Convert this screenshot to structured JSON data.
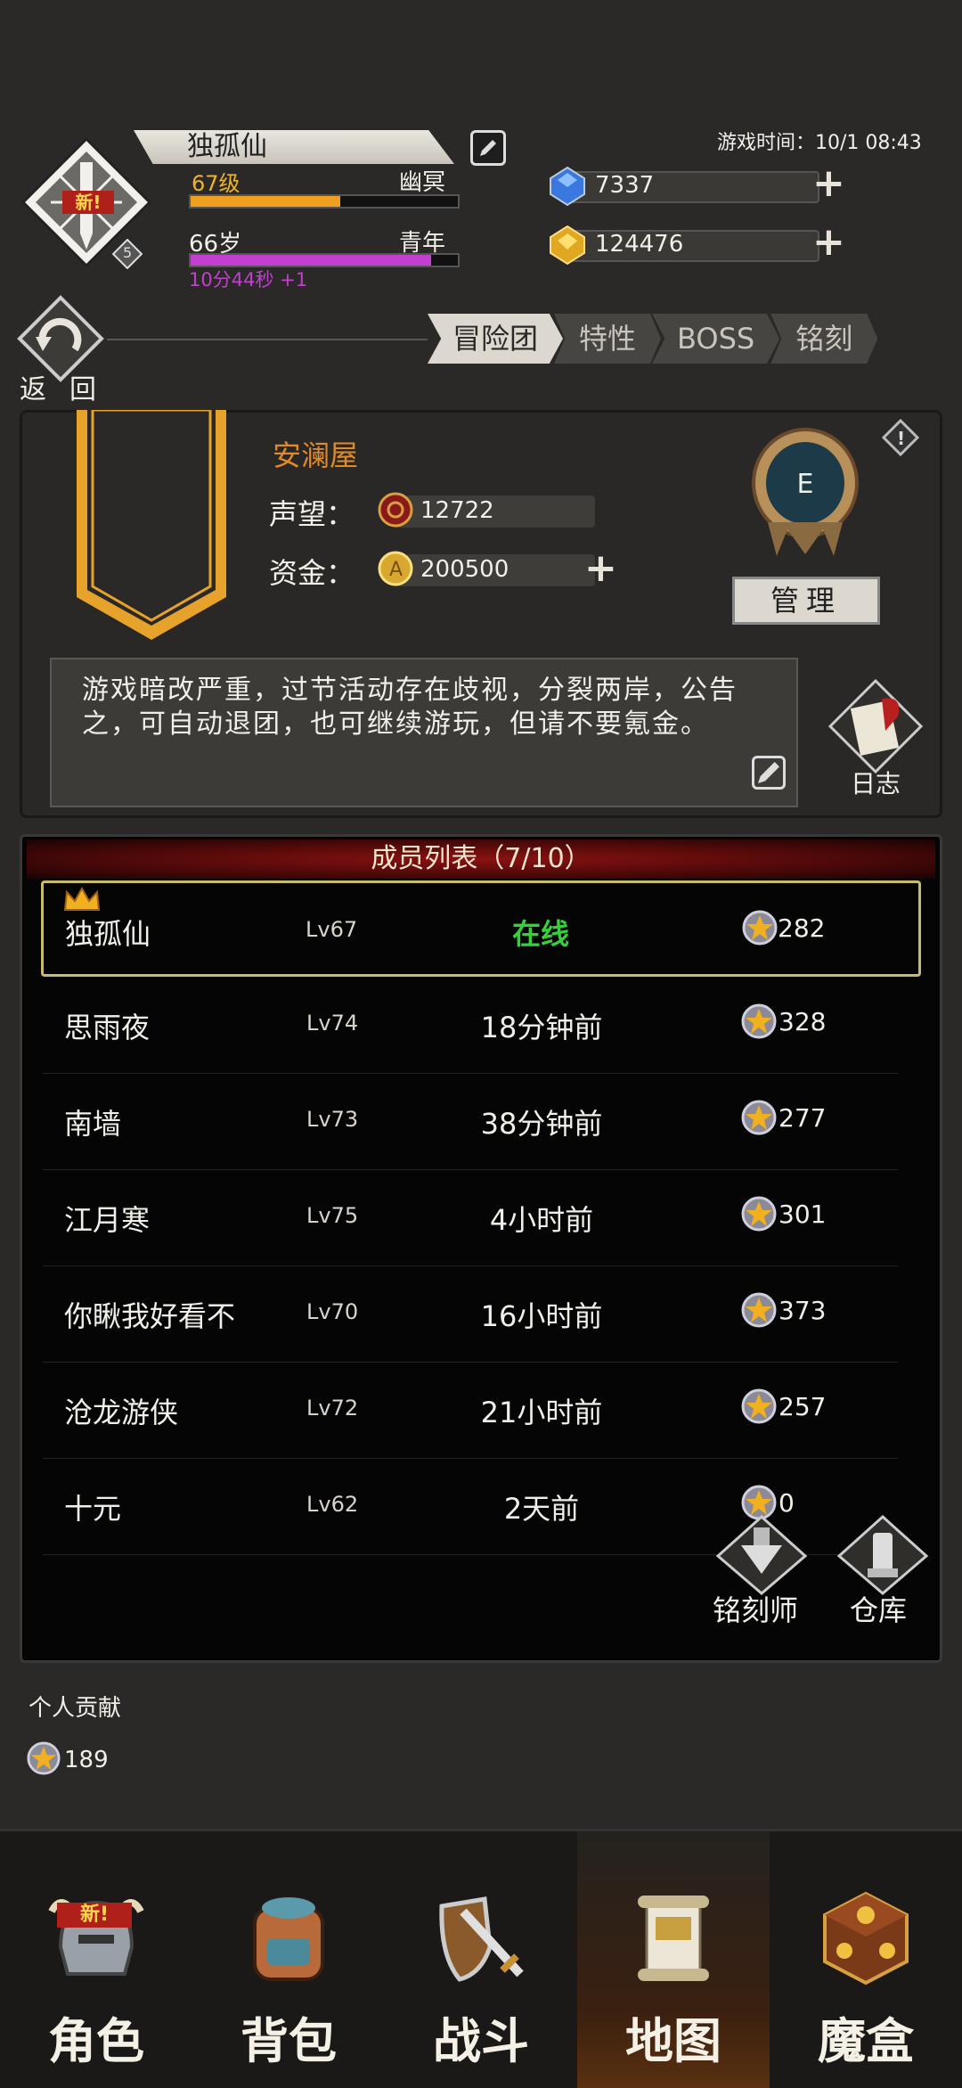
{
  "header": {
    "name": "独孤仙",
    "badge_new": "新!",
    "badge_level": "5",
    "level": "67级",
    "realm": "幽冥",
    "age": "66岁",
    "stage": "青年",
    "timer": "10分44秒 +1",
    "game_time": "游戏时间：10/1 08:43",
    "exp_progress": 0.56,
    "age_progress": 0.9
  },
  "currency": {
    "gems": "7337",
    "gold": "124476"
  },
  "back_label": "返回",
  "tabs": [
    {
      "label": "冒险团",
      "active": true
    },
    {
      "label": "特性",
      "active": false
    },
    {
      "label": "BOSS",
      "active": false
    },
    {
      "label": "铭刻",
      "active": false
    }
  ],
  "guild": {
    "name": "安澜屋",
    "reputation_label": "声望：",
    "reputation": "12722",
    "funds_label": "资金：",
    "funds": "200500",
    "rank": "E",
    "manage_label": "管理",
    "notice": "游戏暗改严重，过节活动存在歧视，分裂两岸，公告之，可自动退团，也可继续游玩，但请不要氪金。",
    "log_label": "日志"
  },
  "members": {
    "title": "成员列表（7/10）",
    "rows": [
      {
        "name": "独孤仙",
        "level": "Lv67",
        "status": "在线",
        "points": "282"
      },
      {
        "name": "思雨夜",
        "level": "Lv74",
        "status": "18分钟前",
        "points": "328"
      },
      {
        "name": "南墙",
        "level": "Lv73",
        "status": "38分钟前",
        "points": "277"
      },
      {
        "name": "江月寒",
        "level": "Lv75",
        "status": "4小时前",
        "points": "301"
      },
      {
        "name": "你瞅我好看不",
        "level": "Lv70",
        "status": "16小时前",
        "points": "373"
      },
      {
        "name": "沧龙游侠",
        "level": "Lv72",
        "status": "21小时前",
        "points": "257"
      },
      {
        "name": "十元",
        "level": "Lv62",
        "status": "2天前",
        "points": "0"
      }
    ],
    "engraver_label": "铭刻师",
    "storage_label": "仓库"
  },
  "contribution": {
    "label": "个人贡献",
    "value": "189"
  },
  "nav": {
    "items": [
      {
        "label": "角色",
        "badge": "新!"
      },
      {
        "label": "背包"
      },
      {
        "label": "战斗"
      },
      {
        "label": "地图"
      },
      {
        "label": "魔盒"
      }
    ]
  },
  "colors": {
    "accent_gold": "#f0b429",
    "online_green": "#35d03c",
    "guild_name": "#e08a2a",
    "timer_purple": "#c33fd0"
  }
}
